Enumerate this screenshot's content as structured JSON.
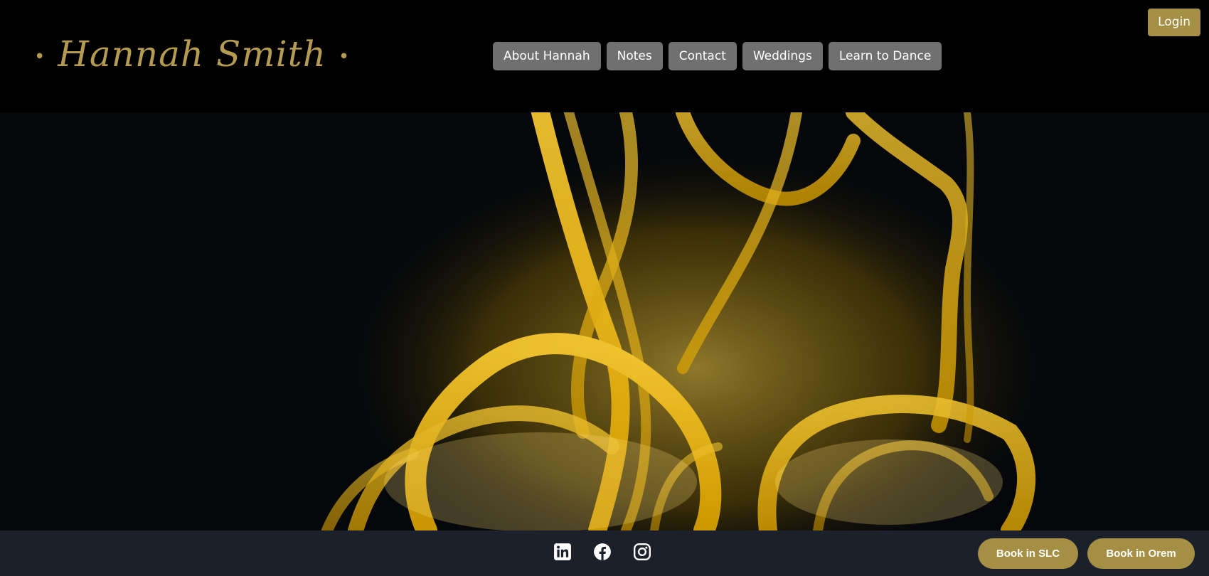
{
  "header": {
    "logo_text": "Hannah Smith",
    "logo_dot": "•",
    "nav": [
      {
        "label": "About Hannah"
      },
      {
        "label": "Notes"
      },
      {
        "label": "Contact"
      },
      {
        "label": "Weddings"
      },
      {
        "label": "Learn to Dance"
      }
    ],
    "login_label": "Login"
  },
  "hero": {
    "image_alt": "Golden smoke / ink swirls on black background"
  },
  "footer": {
    "social_icons": [
      "linkedin-icon",
      "facebook-icon",
      "instagram-icon"
    ],
    "book_slc_label": "Book in SLC",
    "book_orem_label": "Book in Orem"
  },
  "colors": {
    "accent_gold": "#a58f45",
    "logo_gold": "#b59a52",
    "nav_gray": "#707070",
    "footer_bg": "#1b202b",
    "hero_bg": "#05070b"
  }
}
